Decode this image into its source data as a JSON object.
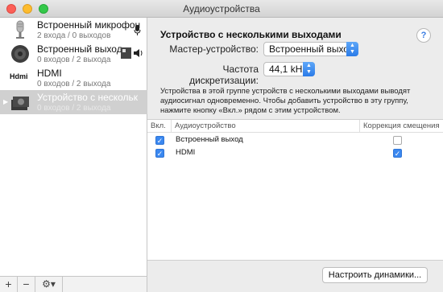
{
  "window": {
    "title": "Аудиоустройства"
  },
  "sidebar": {
    "devices": [
      {
        "name": "Встроенный микрофон",
        "sub": "2 входа / 0 выходов",
        "icon": "microphone-icon",
        "right_icon": "microphone-small-icon"
      },
      {
        "name": "Встроенный выход",
        "sub": "0 входов / 2 выхода",
        "icon": "speaker-icon",
        "right_icon": "speaker-volume-icon"
      },
      {
        "name": "HDMI",
        "sub": "0 входов / 2 выхода",
        "icon": "hdmi-icon"
      },
      {
        "name": "Устройство с нескольк",
        "sub": "0 входов / 2 выхода",
        "icon": "multi-output-icon",
        "selected": true
      }
    ],
    "bottom": {
      "add": "+",
      "remove": "−",
      "gear": "⚙▾"
    }
  },
  "main": {
    "title": "Устройство с несколькими выходами",
    "help": "?",
    "master_label": "Мастер-устройство:",
    "master_value": "Встроенный выход",
    "rate_label": "Частота дискретизации:",
    "rate_value": "44,1 kHz",
    "description": "Устройства в этой группе устройств с несколькими выходами выводят аудиосигнал одновременно. Чтобы добавить устройство в эту группу, нажмите кнопку «Вкл.» рядом с этим устройством.",
    "table": {
      "headers": [
        "Вкл.",
        "Аудиоустройство",
        "Коррекция смещения"
      ],
      "rows": [
        {
          "enabled": true,
          "device": "Встроенный выход",
          "drift": false
        },
        {
          "enabled": true,
          "device": "HDMI",
          "drift": true
        }
      ]
    },
    "configure_button": "Настроить динамики..."
  },
  "colors": {
    "accent": "#3b88f0",
    "selection": "#d0d0d0"
  }
}
